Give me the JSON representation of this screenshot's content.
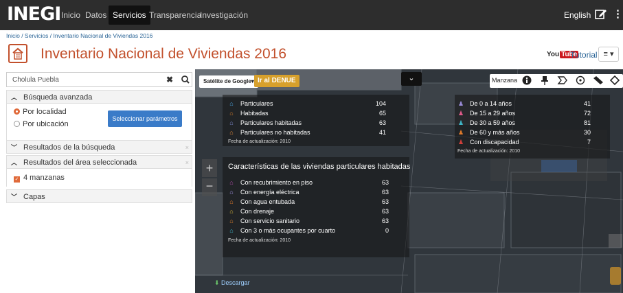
{
  "navbar": {
    "logo": "INEGI",
    "items": [
      "Inicio",
      "Datos",
      "Servicios",
      "Transparencia",
      "Investigación"
    ],
    "active": "Servicios",
    "language": "English",
    "more_icon": "⋮"
  },
  "breadcrumb": "Inicio / Servicios / Inventario Nacional de Viviendas 2016",
  "header": {
    "title": "Inventario Nacional de Viviendas 2016",
    "youtube_label": "You",
    "youtube_badge": "Tube",
    "tutorial": "Tutorial"
  },
  "search": {
    "value": "Cholula Puebla",
    "clear": "✖",
    "search_icon": "magnifier-icon"
  },
  "sidebar": {
    "advanced": {
      "label": "Búsqueda avanzada",
      "options": [
        "Por localidad",
        "Por ubicación"
      ],
      "selected": "Por localidad",
      "button": "Seleccionar parámetros"
    },
    "search_results": {
      "label": "Resultados de la búsqueda"
    },
    "area_results": {
      "label": "Resultados del área seleccionada",
      "item": "4 manzanas",
      "checked": true
    },
    "layers": {
      "label": "Capas"
    },
    "close": "×"
  },
  "map": {
    "base_layer": "Satélite de Google",
    "base_layer_caret": "▾",
    "denue_button": "Ir al DENUE",
    "collapse_icon": "❯",
    "tools": {
      "label": "Manzana"
    },
    "viviendas": [
      {
        "label": "Particulares",
        "value": "104",
        "color": "#4aa3df"
      },
      {
        "label": "Habitadas",
        "value": "65",
        "color": "#d07a2a"
      },
      {
        "label": "Particulares habitadas",
        "value": "63",
        "color": "#7a86c8"
      },
      {
        "label": "Particulares no habitadas",
        "value": "41",
        "color": "#e48a3a"
      }
    ],
    "viviendas_date": "Fecha de actualización: 2010",
    "poblacion": [
      {
        "label": "De 0 a 14 años",
        "value": "41",
        "color": "#9b8cd9"
      },
      {
        "label": "De 15 a 29 años",
        "value": "72",
        "color": "#e05b8a"
      },
      {
        "label": "De 30 a 59 años",
        "value": "81",
        "color": "#3fb6c8"
      },
      {
        "label": "De 60 y más años",
        "value": "30",
        "color": "#e07a2a"
      },
      {
        "label": "Con discapacidad",
        "value": "7",
        "color": "#d0403a"
      }
    ],
    "poblacion_date": "Fecha de actualización: 2010",
    "caracteristicas_title": "Características de las viviendas particulares habitadas",
    "caracteristicas": [
      {
        "label": "Con recubrimiento en piso",
        "value": "63",
        "color": "#b04aa8"
      },
      {
        "label": "Con energía eléctrica",
        "value": "63",
        "color": "#9b8cd9"
      },
      {
        "label": "Con agua entubada",
        "value": "63",
        "color": "#e07a2a"
      },
      {
        "label": "Con drenaje",
        "value": "63",
        "color": "#d9b63a"
      },
      {
        "label": "Con servicio sanitario",
        "value": "63",
        "color": "#d07a2a"
      },
      {
        "label": "Con 3 o más ocupantes por cuarto",
        "value": "0",
        "color": "#3fb6c8"
      }
    ],
    "caracteristicas_date": "Fecha de actualización: 2010",
    "descargar": "Descargar"
  }
}
